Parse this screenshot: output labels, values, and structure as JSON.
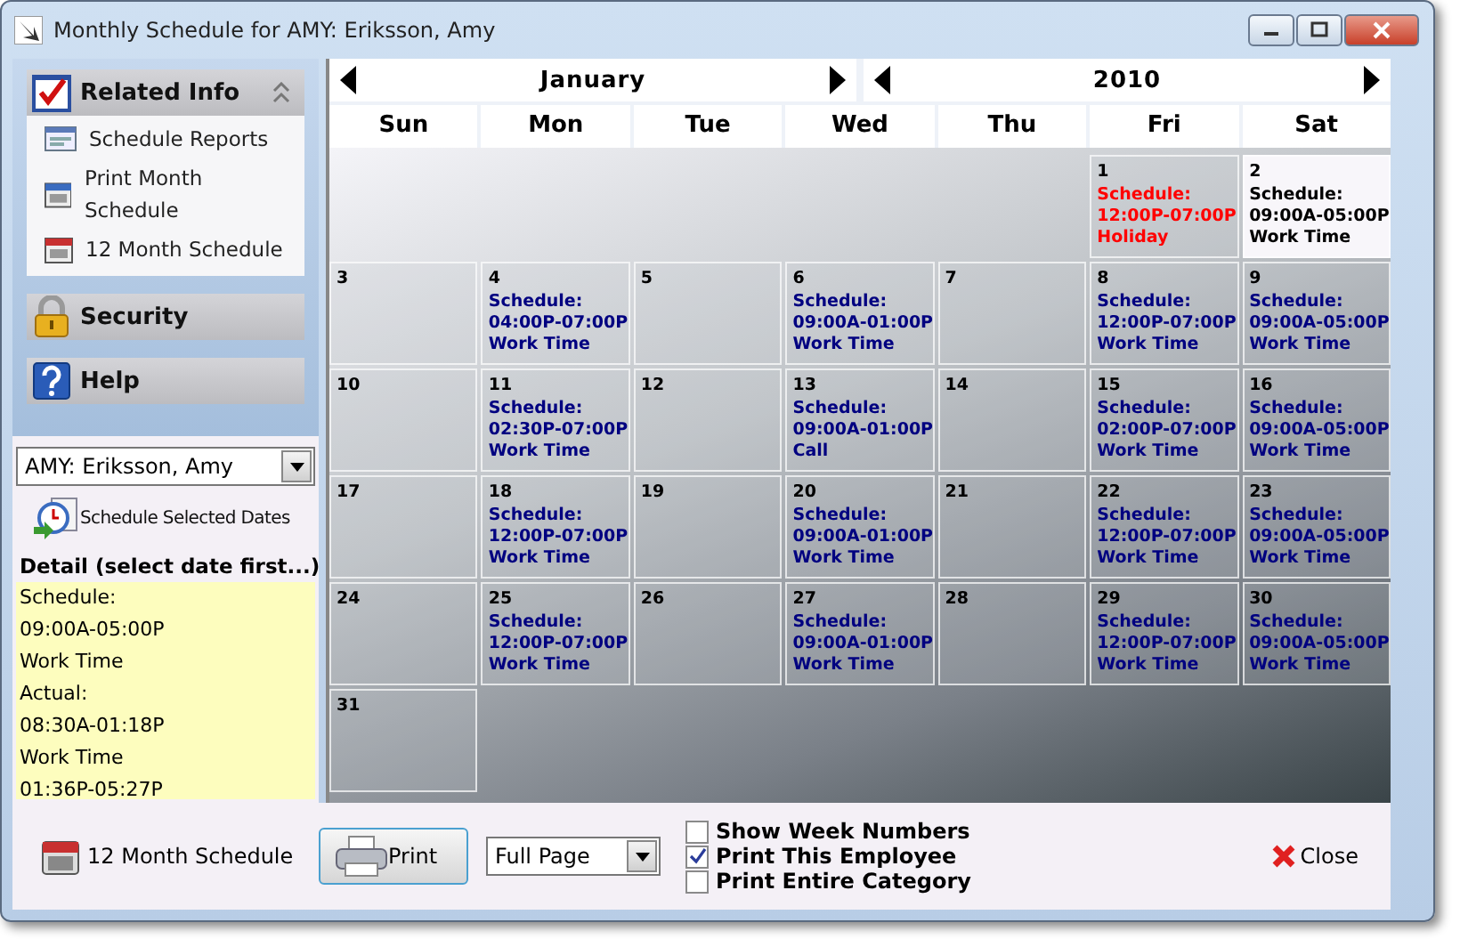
{
  "window": {
    "title": "Monthly Schedule for AMY: Eriksson, Amy"
  },
  "sidebar": {
    "sections": [
      {
        "title": "Related Info",
        "expanded": true,
        "items": [
          {
            "label": "Schedule Reports"
          },
          {
            "label": "Print Month Schedule"
          },
          {
            "label": "12 Month Schedule"
          }
        ]
      },
      {
        "title": "Security",
        "expanded": false
      },
      {
        "title": "Help",
        "expanded": false
      }
    ],
    "employee_select": {
      "value": "AMY: Eriksson, Amy"
    },
    "schedule_button": "Schedule Selected Dates",
    "detail": {
      "label": "Detail (select date first...)",
      "lines": [
        "Schedule:",
        "09:00A-05:00P",
        "Work Time",
        "Actual:",
        "08:30A-01:18P",
        "Work Time",
        "01:36P-05:27P"
      ]
    }
  },
  "calendar": {
    "month": "January",
    "year": "2010",
    "weekdays": [
      "Sun",
      "Mon",
      "Tue",
      "Wed",
      "Thu",
      "Fri",
      "Sat"
    ],
    "weeks": [
      [
        {
          "kind": "empty"
        },
        {
          "kind": "empty"
        },
        {
          "kind": "empty"
        },
        {
          "kind": "empty"
        },
        {
          "kind": "empty"
        },
        {
          "kind": "day",
          "day": "1",
          "selected": false,
          "color": "#ff0000",
          "lines": [
            "Schedule:",
            "12:00P-07:00P",
            "Holiday"
          ]
        },
        {
          "kind": "day",
          "day": "2",
          "selected": true,
          "color": "#000000",
          "lines": [
            "Schedule:",
            "09:00A-05:00P",
            "Work Time"
          ]
        }
      ],
      [
        {
          "kind": "day",
          "day": "3",
          "selected": false
        },
        {
          "kind": "day",
          "day": "4",
          "selected": false,
          "color": "#000080",
          "lines": [
            "Schedule:",
            "04:00P-07:00P",
            "Work Time"
          ]
        },
        {
          "kind": "day",
          "day": "5",
          "selected": false
        },
        {
          "kind": "day",
          "day": "6",
          "selected": false,
          "color": "#000080",
          "lines": [
            "Schedule:",
            "09:00A-01:00P",
            "Work Time"
          ]
        },
        {
          "kind": "day",
          "day": "7",
          "selected": false
        },
        {
          "kind": "day",
          "day": "8",
          "selected": false,
          "color": "#000080",
          "lines": [
            "Schedule:",
            "12:00P-07:00P",
            "Work Time"
          ]
        },
        {
          "kind": "day",
          "day": "9",
          "selected": false,
          "color": "#000080",
          "lines": [
            "Schedule:",
            "09:00A-05:00P",
            "Work Time"
          ]
        }
      ],
      [
        {
          "kind": "day",
          "day": "10",
          "selected": false
        },
        {
          "kind": "day",
          "day": "11",
          "selected": false,
          "color": "#000080",
          "lines": [
            "Schedule:",
            "02:30P-07:00P",
            "Work Time"
          ]
        },
        {
          "kind": "day",
          "day": "12",
          "selected": false
        },
        {
          "kind": "day",
          "day": "13",
          "selected": false,
          "color": "#000080",
          "lines": [
            "Schedule:",
            "09:00A-01:00P",
            "Call"
          ]
        },
        {
          "kind": "day",
          "day": "14",
          "selected": false
        },
        {
          "kind": "day",
          "day": "15",
          "selected": false,
          "color": "#000080",
          "lines": [
            "Schedule:",
            "02:00P-07:00P",
            "Work Time"
          ]
        },
        {
          "kind": "day",
          "day": "16",
          "selected": false,
          "color": "#000080",
          "lines": [
            "Schedule:",
            "09:00A-05:00P",
            "Work Time"
          ]
        }
      ],
      [
        {
          "kind": "day",
          "day": "17",
          "selected": false
        },
        {
          "kind": "day",
          "day": "18",
          "selected": false,
          "color": "#000080",
          "lines": [
            "Schedule:",
            "12:00P-07:00P",
            "Work Time"
          ]
        },
        {
          "kind": "day",
          "day": "19",
          "selected": false
        },
        {
          "kind": "day",
          "day": "20",
          "selected": false,
          "color": "#000080",
          "lines": [
            "Schedule:",
            "09:00A-01:00P",
            "Work Time"
          ]
        },
        {
          "kind": "day",
          "day": "21",
          "selected": false
        },
        {
          "kind": "day",
          "day": "22",
          "selected": false,
          "color": "#000080",
          "lines": [
            "Schedule:",
            "12:00P-07:00P",
            "Work Time"
          ]
        },
        {
          "kind": "day",
          "day": "23",
          "selected": false,
          "color": "#000080",
          "lines": [
            "Schedule:",
            "09:00A-05:00P",
            "Work Time"
          ]
        }
      ],
      [
        {
          "kind": "day",
          "day": "24",
          "selected": false
        },
        {
          "kind": "day",
          "day": "25",
          "selected": false,
          "color": "#000080",
          "lines": [
            "Schedule:",
            "12:00P-07:00P",
            "Work Time"
          ]
        },
        {
          "kind": "day",
          "day": "26",
          "selected": false
        },
        {
          "kind": "day",
          "day": "27",
          "selected": false,
          "color": "#000080",
          "lines": [
            "Schedule:",
            "09:00A-01:00P",
            "Work Time"
          ]
        },
        {
          "kind": "day",
          "day": "28",
          "selected": false
        },
        {
          "kind": "day",
          "day": "29",
          "selected": false,
          "color": "#000080",
          "lines": [
            "Schedule:",
            "12:00P-07:00P",
            "Work Time"
          ]
        },
        {
          "kind": "day",
          "day": "30",
          "selected": false,
          "color": "#000080",
          "lines": [
            "Schedule:",
            "09:00A-05:00P",
            "Work Time"
          ]
        }
      ],
      [
        {
          "kind": "day",
          "day": "31",
          "selected": false
        }
      ]
    ]
  },
  "footer": {
    "twelve_month": "12 Month Schedule",
    "print_button": "Print",
    "page_select": {
      "value": "Full Page"
    },
    "options": [
      {
        "label": "Show Week Numbers",
        "checked": false
      },
      {
        "label": "Print This Employee",
        "checked": true
      },
      {
        "label": "Print Entire Category",
        "checked": false
      }
    ],
    "close_button": "Close"
  }
}
